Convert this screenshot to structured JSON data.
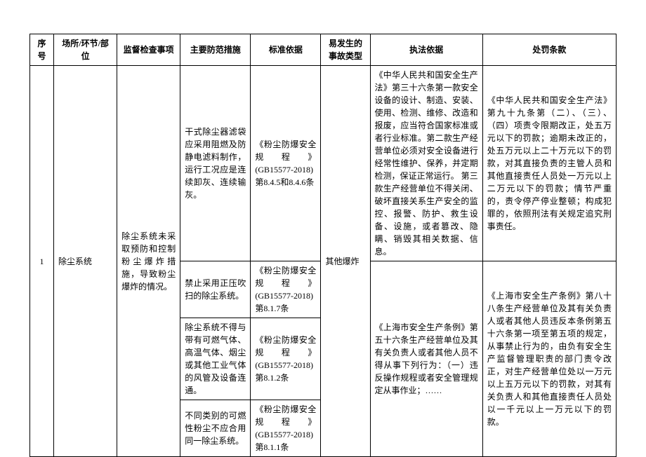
{
  "headers": {
    "seq": "序号",
    "place": "场所/环节/部位",
    "check": "监督检查事项",
    "measure": "主要防范措施",
    "standard": "标准依据",
    "accident": "易发生的事故类型",
    "law": "执法依据",
    "penalty": "处罚条款"
  },
  "row": {
    "seq": "1",
    "place": "除尘系统",
    "check": "除尘系统未采取预防和控制粉尘爆炸措施，导致粉尘爆炸的情况。",
    "accident": "其他爆炸",
    "measures": [
      "干式除尘器滤袋应采用阻燃及防静电滤料制作，运行工况应是连续卸灰、连续输灰。",
      "禁止采用正压吹扫的除尘系统。",
      "除尘系统不得与带有可燃气体、高温气体、烟尘或其他工业气体的风管及设备连通。",
      "不同类别的可燃性粉尘不应合用同一除尘系统。"
    ],
    "standards": [
      "《粉尘防爆安全规程》(GB15577-2018)第8.4.5和8.4.6条",
      "《粉尘防爆安全规程》(GB15577-2018)第8.1.7条",
      "《粉尘防爆安全规程》(GB15577-2018)第8.1.2条",
      "《粉尘防爆安全规程》(GB15577-2018)第8.1.1条"
    ],
    "laws": [
      "《中华人民共和国安全生产法》第三十六条第一款安全设备的设计、制造、安装、使用、检测、维修、改造和报废，应当符合国家标准或者行业标准。第二款生产经营单位必须对安全设备进行经常性维护、保养，并定期检测，保证正常运行。\n第三款生产经营单位不得关闭、破坏直接关系生产安全的监控、报警、防护、救生设备、设施，或者篡改、隐瞒、销毁其相关数据、信息。",
      "《上海市安全生产条例》第五十六条生产经营单位及其有关负责人或者其他人员不得从事下列行为：（一）违反操作规程或者安全管理规定从事作业；……"
    ],
    "penalties": [
      "《中华人民共和国安全生产法》第九十九条第（二）、（三）、\n（四）项责令限期改正，处五万元以下的罚款；逾期未改正的，处五万元以上二十万元以下的罚款，对其直接负责的主管人员和其他直接责任人员处一万元以上二万元以下的罚款；情节严重的，责令停产停业整顿；构成犯罪的，依照刑法有关规定追究刑事责任。",
      "《上海市安全生产条例》第八十八条生产经营单位及其有关负责人或者其他人员违反本条例第五十六条第一项至第五项的规定，从事禁止行为的，由负有安全生产监督管理职责的部门责令改正，对生产经营单位处以一万元以上五万元以下的罚款，对其有关负责人和其他直接责任人员处以一千元以上一万元以下的罚款。"
    ]
  }
}
